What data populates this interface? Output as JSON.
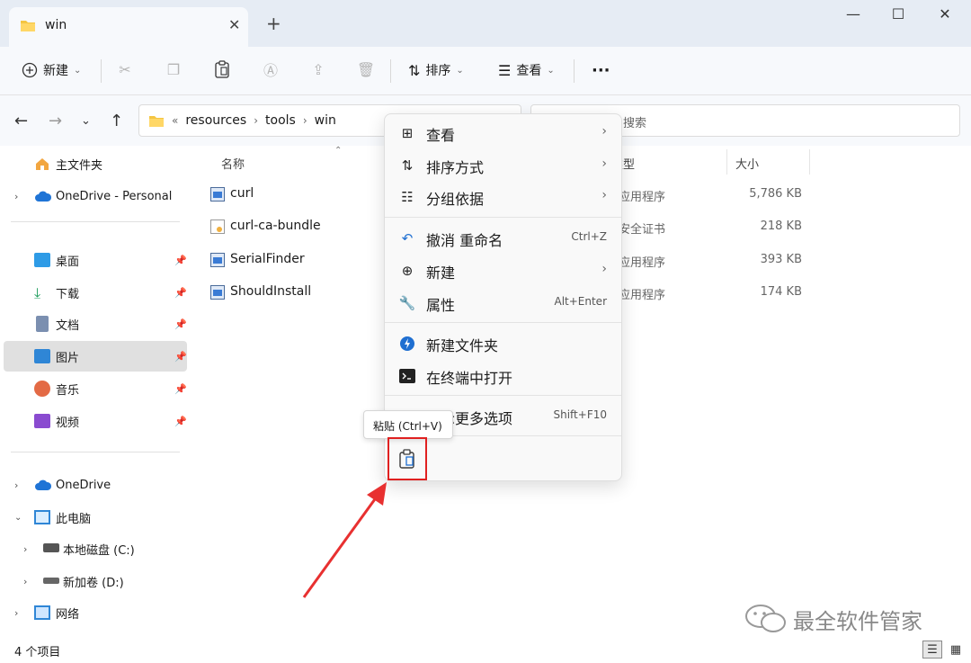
{
  "window": {
    "tab_title": "win",
    "tab_close": "✕",
    "new_tab": "+",
    "minimize": "—",
    "maximize": "☐",
    "close": "✕"
  },
  "toolbar": {
    "new_label": "新建",
    "sort_label": "排序",
    "view_label": "查看",
    "more": "···"
  },
  "address": {
    "overflow": "«",
    "crumbs": [
      "resources",
      "tools",
      "win"
    ],
    "search_placeholder": "搜索"
  },
  "sidebar": {
    "home": "主文件夹",
    "onedrive_personal": "OneDrive - Personal",
    "desktop": "桌面",
    "downloads": "下载",
    "documents": "文档",
    "pictures": "图片",
    "music": "音乐",
    "videos": "视频",
    "onedrive": "OneDrive",
    "this_pc": "此电脑",
    "drive_c": "本地磁盘 (C:)",
    "drive_d": "新加卷 (D:)",
    "network": "网络"
  },
  "columns": {
    "name": "名称",
    "type": "类型",
    "size": "大小"
  },
  "files": [
    {
      "name": "curl",
      "type": "应用程序",
      "size": "5,786 KB"
    },
    {
      "name": "curl-ca-bundle",
      "type": "安全证书",
      "size": "218 KB"
    },
    {
      "name": "SerialFinder",
      "type": "应用程序",
      "size": "393 KB"
    },
    {
      "name": "ShouldInstall",
      "type": "应用程序",
      "size": "174 KB"
    }
  ],
  "context_menu": {
    "view": "查看",
    "sort": "排序方式",
    "group": "分组依据",
    "undo": "撤消 重命名",
    "undo_key": "Ctrl+Z",
    "new": "新建",
    "properties": "属性",
    "properties_key": "Alt+Enter",
    "new_folder": "新建文件夹",
    "open_terminal": "在终端中打开",
    "more_options": "显示更多选项",
    "more_options_key": "Shift+F10"
  },
  "tooltip": "粘贴 (Ctrl+V)",
  "status": {
    "item_count": "4 个项目"
  },
  "watermark": "最全软件管家",
  "colors": {
    "accent": "#0067c0",
    "highlight_box": "#e02020",
    "arrow": "#e83030"
  }
}
